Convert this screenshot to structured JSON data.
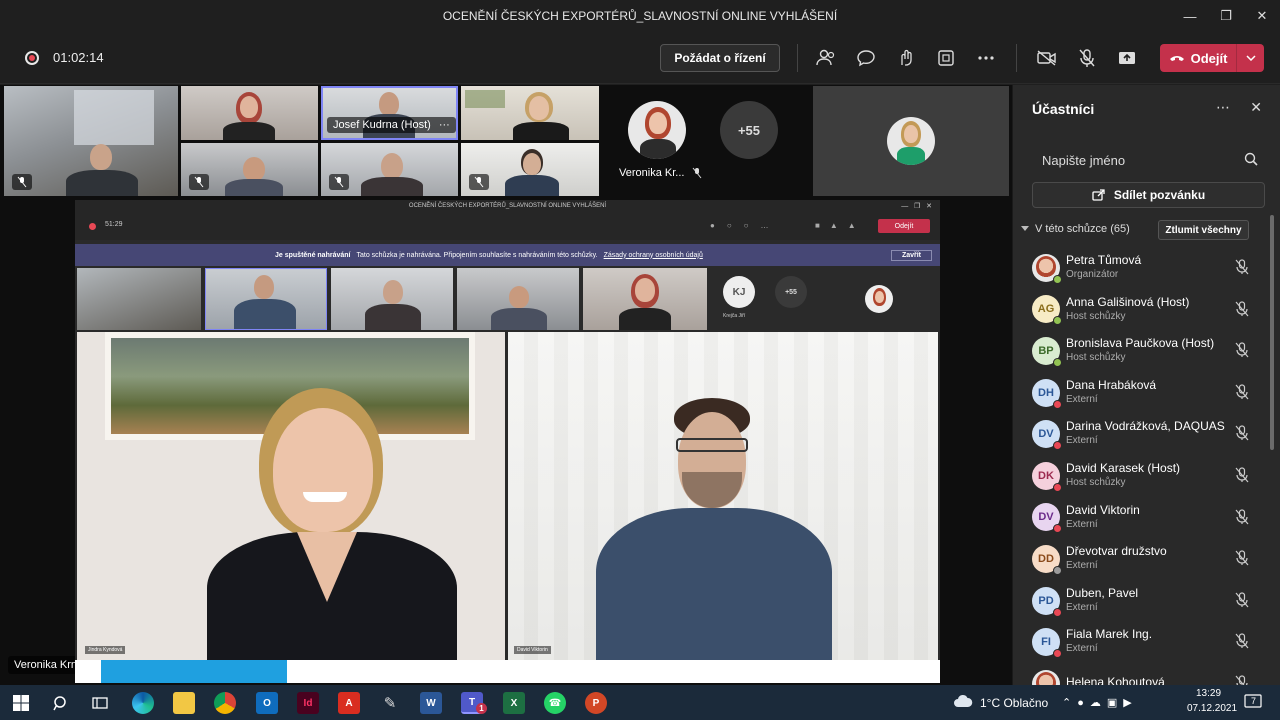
{
  "window": {
    "title": "OCENĚNÍ ČESKÝCH EXPORTÉRŮ_SLAVNOSTNÍ ONLINE VYHLÁŠENÍ"
  },
  "toolbar": {
    "timer": "01:02:14",
    "request_label": "Požádat o řízení",
    "leave_label": "Odejít"
  },
  "gallery": {
    "host_label": "Josef Kudrna (Host)",
    "host_more": "···",
    "veronika_label": "Veronika Kr...",
    "overflow_count": "+55"
  },
  "stage": {
    "speaker_label": "Veronika Krnáčová",
    "inner": {
      "title": "OCENĚNÍ ČESKÝCH EXPORTÉRŮ_SLAVNOSTNÍ ONLINE VYHLÁŠENÍ",
      "timer": "51:29",
      "banner_bold": "Je spuštěné nahrávání",
      "banner_text": "Tato schůzka je nahrávána. Připojením souhlasíte s nahráváním této schůzky.",
      "banner_link": "Zásady ochrany osobních údajů",
      "banner_close": "Zavřít",
      "leave_label": "Odejít",
      "kj_initials": "KJ",
      "kj_label": "Krejča Jiří",
      "overflow": "+55",
      "left_name": "Jindra Kyndová",
      "right_name": "David Viktorin"
    }
  },
  "panel": {
    "title": "Účastníci",
    "search_placeholder": "Napište jméno",
    "share_label": "Sdílet pozvánku",
    "section_label": "V této schůzce (65)",
    "mute_all": "Ztlumit všechny",
    "participants": [
      {
        "initials": "",
        "name": "Petra Tůmová",
        "role": "Organizátor",
        "bg": "#e8e8e8",
        "fg": "#333",
        "status": "#92c353",
        "photo": true
      },
      {
        "initials": "AG",
        "name": "Anna Gališinová (Host)",
        "role": "Host schůzky",
        "bg": "#f7ebc5",
        "fg": "#8a6d1a",
        "status": "#92c353"
      },
      {
        "initials": "BP",
        "name": "Bronislava Paučkova (Host)",
        "role": "Host schůzky",
        "bg": "#d9ecd0",
        "fg": "#3c6b2a",
        "status": "#92c353"
      },
      {
        "initials": "DH",
        "name": "Dana Hrabáková",
        "role": "Externí",
        "bg": "#cfe0f5",
        "fg": "#2b5797",
        "status": "#e84855"
      },
      {
        "initials": "DV",
        "name": "Darina Vodrážková, DAQUAS",
        "role": "Externí",
        "bg": "#cfe0f5",
        "fg": "#2b5797",
        "status": "#e84855"
      },
      {
        "initials": "DK",
        "name": "David Karasek (Host)",
        "role": "Host schůzky",
        "bg": "#f5d0dc",
        "fg": "#9c2a4f",
        "status": "#e84855"
      },
      {
        "initials": "DV",
        "name": "David Viktorin",
        "role": "Externí",
        "bg": "#e8d5f0",
        "fg": "#6b2a8a",
        "status": "#e84855"
      },
      {
        "initials": "DD",
        "name": "Dřevotvar družstvo",
        "role": "Externí",
        "bg": "#f7dcc7",
        "fg": "#8a4a1a",
        "status": "#9b9b9b"
      },
      {
        "initials": "PD",
        "name": "Duben, Pavel",
        "role": "Externí",
        "bg": "#cfe0f5",
        "fg": "#2b5797",
        "status": "#e84855"
      },
      {
        "initials": "FI",
        "name": "Fiala Marek Ing.",
        "role": "Externí",
        "bg": "#cfe0f5",
        "fg": "#2b5797",
        "status": "#e84855"
      },
      {
        "initials": "",
        "name": "Helena Kohoutová",
        "role": "",
        "bg": "#e8e8e8",
        "fg": "#333",
        "status": "",
        "photo": true
      }
    ]
  },
  "taskbar": {
    "weather": "1°C  Oblačno",
    "time": "13:29",
    "date": "07.12.2021",
    "notif_count": "7",
    "teams_badge": "1"
  },
  "colors": {
    "accent": "#c4314b",
    "panel": "#292929",
    "banner": "#464775",
    "online": "#92c353",
    "busy": "#e84855"
  }
}
